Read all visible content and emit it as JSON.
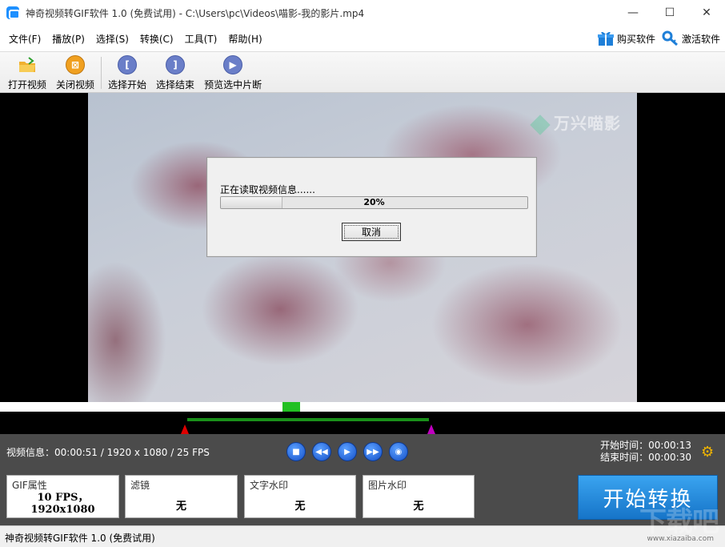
{
  "titlebar": {
    "title": "神奇视频转GIF软件 1.0 (免费试用)  - C:\\Users\\pc\\Videos\\喵影-我的影片.mp4",
    "minimize": "—",
    "maximize": "☐",
    "close": "✕"
  },
  "menu": {
    "items": [
      "文件(F)",
      "播放(P)",
      "选择(S)",
      "转换(C)",
      "工具(T)",
      "帮助(H)"
    ],
    "buy": "购买软件",
    "activate": "激活软件"
  },
  "toolbar": {
    "open": "打开视频",
    "close": "关闭视频",
    "select_start": "选择开始",
    "select_end": "选择结束",
    "preview": "预览选中片断"
  },
  "video": {
    "watermark": "万兴喵影"
  },
  "dialog": {
    "message": "正在读取视频信息......",
    "progress_percent": 20,
    "progress_label": "20%",
    "cancel": "取消"
  },
  "timeline": {
    "playhead_fraction": 0.402,
    "range_start_fraction": 0.258,
    "range_end_fraction": 0.592
  },
  "info": {
    "video_info": "视频信息：00:00:51 / 1920 x 1080 / 25 FPS",
    "start_time": "开始时间：00:00:13",
    "end_time": "结束时间：00:00:30"
  },
  "props": {
    "gif_title": "GIF属性",
    "gif_value_line1": "10 FPS，",
    "gif_value_line2": "1920x1080",
    "filter_title": "滤镜",
    "filter_value": "无",
    "text_wm_title": "文字水印",
    "text_wm_value": "无",
    "image_wm_title": "图片水印",
    "image_wm_value": "无",
    "start_convert": "开始转换"
  },
  "status": {
    "text": "神奇视频转GIF软件 1.0 (免费试用)"
  },
  "site_watermark": {
    "logo": "下载吧",
    "url": "www.xiazaiba.com"
  }
}
